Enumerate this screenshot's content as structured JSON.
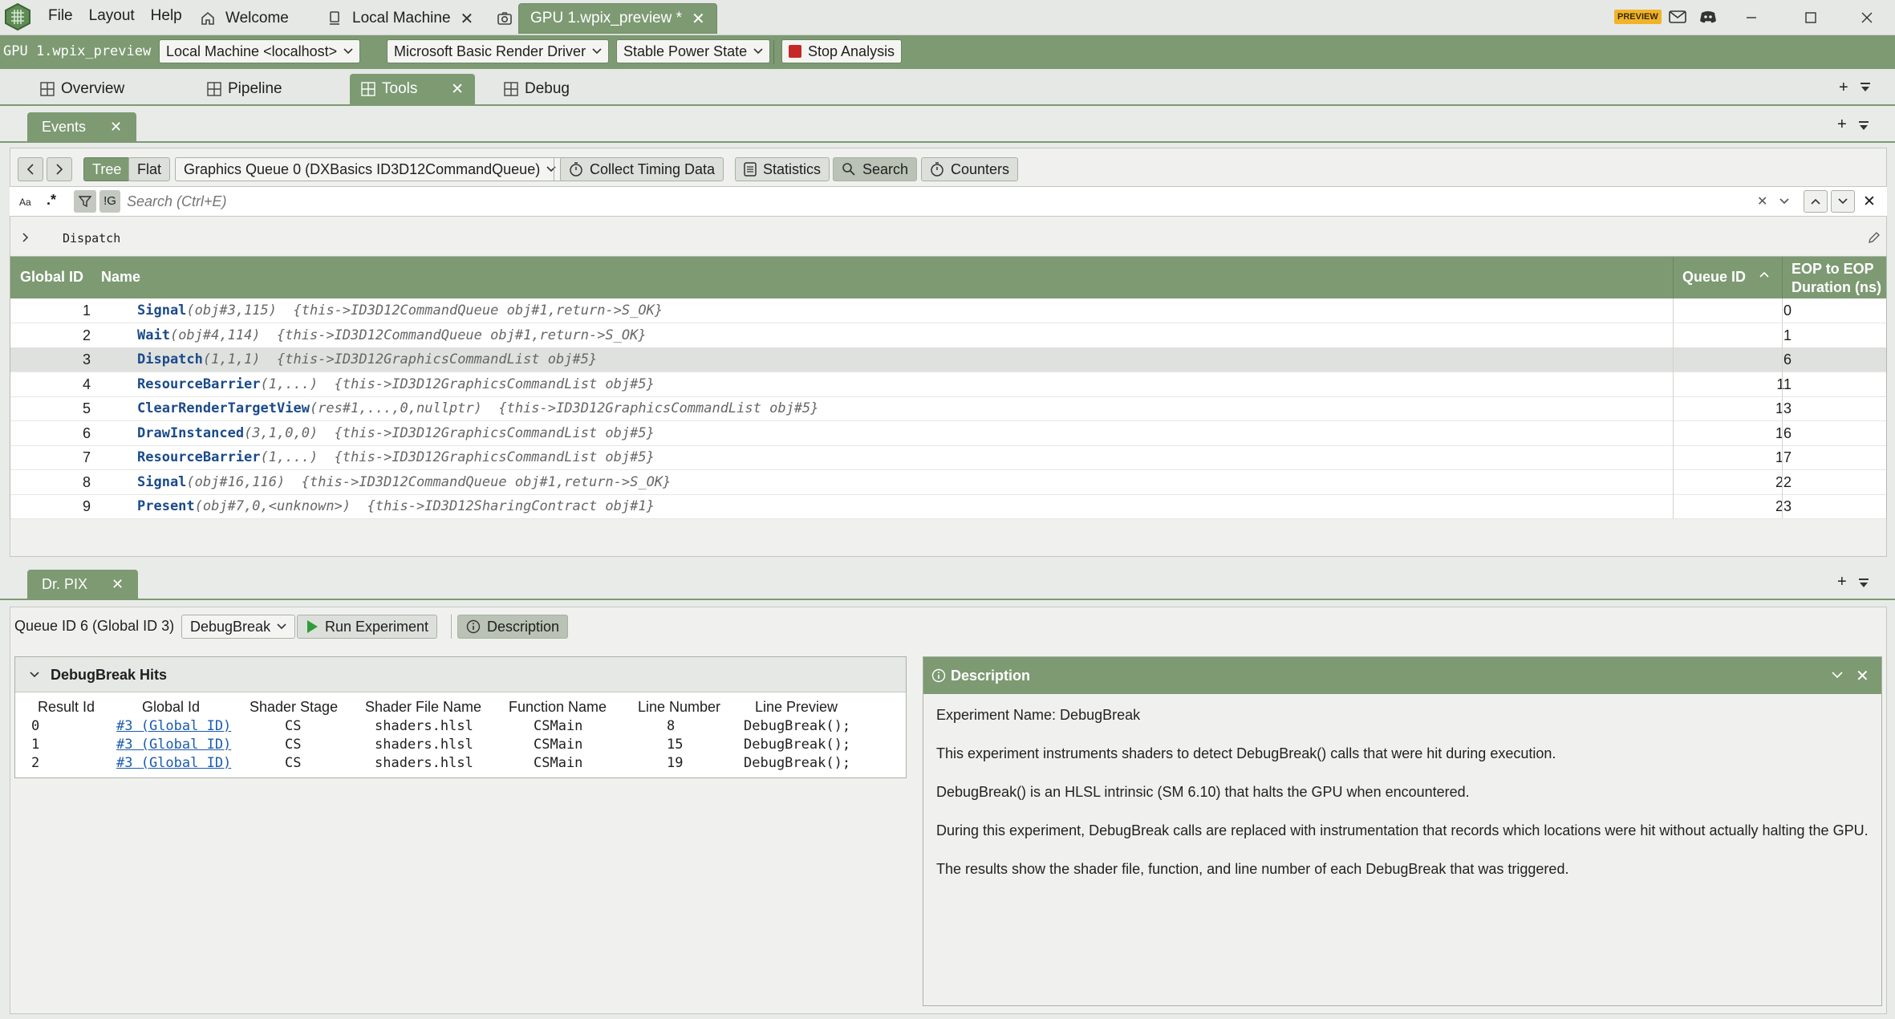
{
  "menu": [
    "File",
    "Layout",
    "Help"
  ],
  "top_tabs": [
    {
      "label": "Welcome"
    },
    {
      "label": "Local Machine"
    },
    {
      "label": "GPU 1.wpix_preview *"
    }
  ],
  "preview_badge": "PREVIEW",
  "toolbar": {
    "capture_name": "GPU 1.wpix_preview",
    "machine": "Local Machine <localhost>",
    "driver": "Microsoft Basic Render Driver",
    "power_state": "Stable Power State",
    "stop_analysis": "Stop Analysis"
  },
  "doc_tabs": [
    "Overview",
    "Pipeline",
    "Tools",
    "Debug"
  ],
  "events_panel": {
    "tab_label": "Events",
    "tree_label": "Tree",
    "flat_label": "Flat",
    "queue_select": "Graphics Queue 0 (DXBasics ID3D12CommandQueue)",
    "collect_timing": "Collect Timing Data",
    "statistics": "Statistics",
    "search": "Search",
    "counters": "Counters",
    "search_case": "Aa",
    "search_regex": ".*",
    "search_group": "!G",
    "search_placeholder": "Search (Ctrl+E)",
    "filter_text": "Dispatch",
    "columns": {
      "global_id": "Global ID",
      "name": "Name",
      "queue_id": "Queue ID",
      "eop_line1": "EOP to EOP",
      "eop_line2": "Duration (ns)"
    },
    "rows": [
      {
        "gid": "1",
        "fn": "Signal",
        "args": "(obj#3,115)",
        "meta": "{this->ID3D12CommandQueue obj#1,return->S_OK}",
        "qid": "0"
      },
      {
        "gid": "2",
        "fn": "Wait",
        "args": "(obj#4,114)",
        "meta": "{this->ID3D12CommandQueue obj#1,return->S_OK}",
        "qid": "1"
      },
      {
        "gid": "3",
        "fn": "Dispatch",
        "args": "(1,1,1)",
        "meta": "{this->ID3D12GraphicsCommandList obj#5}",
        "qid": "6"
      },
      {
        "gid": "4",
        "fn": "ResourceBarrier",
        "args": "(1,...)",
        "meta": "{this->ID3D12GraphicsCommandList obj#5}",
        "qid": "11"
      },
      {
        "gid": "5",
        "fn": "ClearRenderTargetView",
        "args": "(res#1,...,0,nullptr)",
        "meta": "{this->ID3D12GraphicsCommandList obj#5}",
        "qid": "13"
      },
      {
        "gid": "6",
        "fn": "DrawInstanced",
        "args": "(3,1,0,0)",
        "meta": "{this->ID3D12GraphicsCommandList obj#5}",
        "qid": "16"
      },
      {
        "gid": "7",
        "fn": "ResourceBarrier",
        "args": "(1,...)",
        "meta": "{this->ID3D12GraphicsCommandList obj#5}",
        "qid": "17"
      },
      {
        "gid": "8",
        "fn": "Signal",
        "args": "(obj#16,116)",
        "meta": "{this->ID3D12CommandQueue obj#1,return->S_OK}",
        "qid": "22"
      },
      {
        "gid": "9",
        "fn": "Present",
        "args": "(obj#7,0,<unknown>)",
        "meta": "{this->ID3D12SharingContract obj#1}",
        "qid": "23"
      }
    ]
  },
  "drpix_panel": {
    "tab_label": "Dr. PIX",
    "queue_label": "Queue ID 6 (Global ID 3)",
    "experiment_select": "DebugBreak",
    "run_experiment": "Run Experiment",
    "description_btn": "Description",
    "hits": {
      "title": "DebugBreak Hits",
      "columns": [
        "Result Id",
        "Global Id",
        "Shader Stage",
        "Shader File Name",
        "Function Name",
        "Line Number",
        "Line Preview"
      ],
      "rows": [
        {
          "result_id": "0",
          "global_id": "#3 (Global ID)",
          "stage": "CS",
          "file": "shaders.hlsl",
          "function": "CSMain",
          "line": "8",
          "preview": "DebugBreak();"
        },
        {
          "result_id": "1",
          "global_id": "#3 (Global ID)",
          "stage": "CS",
          "file": "shaders.hlsl",
          "function": "CSMain",
          "line": "15",
          "preview": "DebugBreak();"
        },
        {
          "result_id": "2",
          "global_id": "#3 (Global ID)",
          "stage": "CS",
          "file": "shaders.hlsl",
          "function": "CSMain",
          "line": "19",
          "preview": "DebugBreak();"
        }
      ]
    },
    "description": {
      "title": "Description",
      "lines": [
        "Experiment Name: DebugBreak",
        "This experiment instruments shaders to detect DebugBreak() calls that were hit during execution.",
        "DebugBreak() is an HLSL intrinsic (SM 6.10) that halts the GPU when encountered.",
        "During this experiment, DebugBreak calls are replaced with instrumentation that records which locations were hit without actually halting the GPU.",
        "The results show the shader file, function, and line number of each DebugBreak that was triggered."
      ]
    }
  },
  "colors": {
    "accent": "#7d9a73",
    "selected_row": "#dfe1de",
    "function_name": "#1a4a8a",
    "link": "#1a5bb0",
    "stop_red": "#c62828"
  }
}
